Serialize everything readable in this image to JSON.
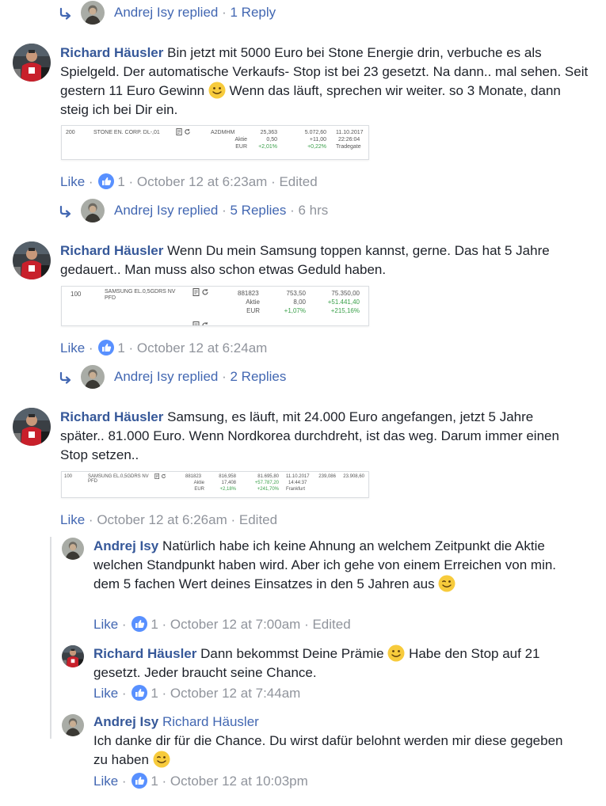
{
  "reply_summaries": [
    {
      "name": "Andrej Isy",
      "action": "replied",
      "count": "1 Reply",
      "time": ""
    },
    {
      "name": "Andrej Isy",
      "action": "replied",
      "count": "5 Replies",
      "time": "6 hrs"
    },
    {
      "name": "Andrej Isy",
      "action": "replied",
      "count": "2 Replies",
      "time": ""
    }
  ],
  "comments": [
    {
      "author": "Richard Häusler",
      "text_1": "Bin jetzt mit 5000 Euro bei Stone Energie drin, verbuche es als Spielgeld. Der automatische Verkaufs- Stop ist bei 23 gesetzt. Na dann.. mal sehen. Seit gestern 11 Euro Gewinn",
      "text_2": "Wenn das läuft, sprechen wir weiter. so 3 Monate, dann steig ich bei Dir ein.",
      "like_label": "Like",
      "like_count": "1",
      "time": "October 12 at 6:23am",
      "edited": "Edited"
    },
    {
      "author": "Richard Häusler",
      "text_1": "Wenn Du mein Samsung toppen kannst, gerne. Das hat 5 Jahre gedauert.. Man muss also schon etwas Geduld haben.",
      "like_label": "Like",
      "like_count": "1",
      "time": "October 12 at 6:24am"
    },
    {
      "author": "Richard Häusler",
      "text_1": "Samsung, es läuft, mit 24.000 Euro angefangen, jetzt 5 Jahre später.. 81.000 Euro. Wenn Nordkorea durchdreht, ist das weg. Darum immer einen Stop setzen..",
      "like_label": "Like",
      "time": "October 12 at 6:26am",
      "edited": "Edited"
    }
  ],
  "replies": [
    {
      "author": "Andrej Isy",
      "text_1": "Natürlich habe ich keine Ahnung an welchem Zeitpunkt die Aktie welchen Standpunkt haben wird. Aber ich gehe von einem Erreichen von min. dem 5 fachen Wert deines Einsatzes in den 5 Jahren aus",
      "like_label": "Like",
      "like_count": "1",
      "time": "October 12 at 7:00am",
      "edited": "Edited"
    },
    {
      "author": "Richard Häusler",
      "text_1": "Dann bekommst Deine Prämie",
      "text_2": "Habe den Stop auf 21 gesetzt. Jeder braucht seine Chance.",
      "like_label": "Like",
      "like_count": "1",
      "time": "October 12 at 7:44am"
    },
    {
      "author": "Andrej Isy",
      "mention": "Richard Häusler",
      "text_1": "Ich danke dir für die Chance. Du wirst dafür belohnt werden mir diese gegeben zu haben",
      "like_label": "Like",
      "like_count": "1",
      "time": "October 12 at 10:03pm"
    }
  ],
  "portfolio_rows": [
    {
      "qty": "200",
      "stock": "STONE EN. CORP. DL-,01",
      "wkn": "A2DMHM",
      "price": "25,363",
      "value": "5.072,60",
      "date": "11.10.2017",
      "label_aktie": "Aktie",
      "label_eur": "EUR",
      "chg_aktie": "0,50",
      "chg_aktie_abs": "+11,00",
      "time": "22:26:04",
      "chg_pct": "+2,01%",
      "chg_pct_total": "+0,22%",
      "exchange": "Tradegate"
    },
    {
      "qty": "100",
      "stock_line1": "SAMSUNG EL.0,5GDRS NV",
      "stock_line2": "PFD",
      "wkn": "881823",
      "price": "753,50",
      "value": "75.350,00",
      "label_aktie": "Aktie",
      "label_eur": "EUR",
      "chg_aktie": "8,00",
      "chg_aktie_abs": "+51.441,40",
      "chg_pct": "+1,07%",
      "chg_pct_total": "+215,16%"
    },
    {
      "qty": "100",
      "stock_line1": "SAMSUNG EL.0,5GDRS NV",
      "stock_line2": "PFD",
      "wkn": "881823",
      "price": "816,958",
      "value": "81.695,80",
      "date": "11.10.2017",
      "extra_1": "239,086",
      "extra_2": "23.908,60",
      "label_aktie": "Aktie",
      "label_eur": "EUR",
      "chg_aktie": "17,408",
      "chg_aktie_abs": "+57.787,20",
      "time": "14:44:37",
      "chg_pct": "+2,18%",
      "chg_pct_total": "+241,70%",
      "exchange": "Frankfurt"
    }
  ],
  "colors": {
    "link": "#4267b2",
    "name": "#365899",
    "meta": "#90949c",
    "text": "#1d2129",
    "like_badge": "#5890ff",
    "positive": "#3aa04a"
  }
}
